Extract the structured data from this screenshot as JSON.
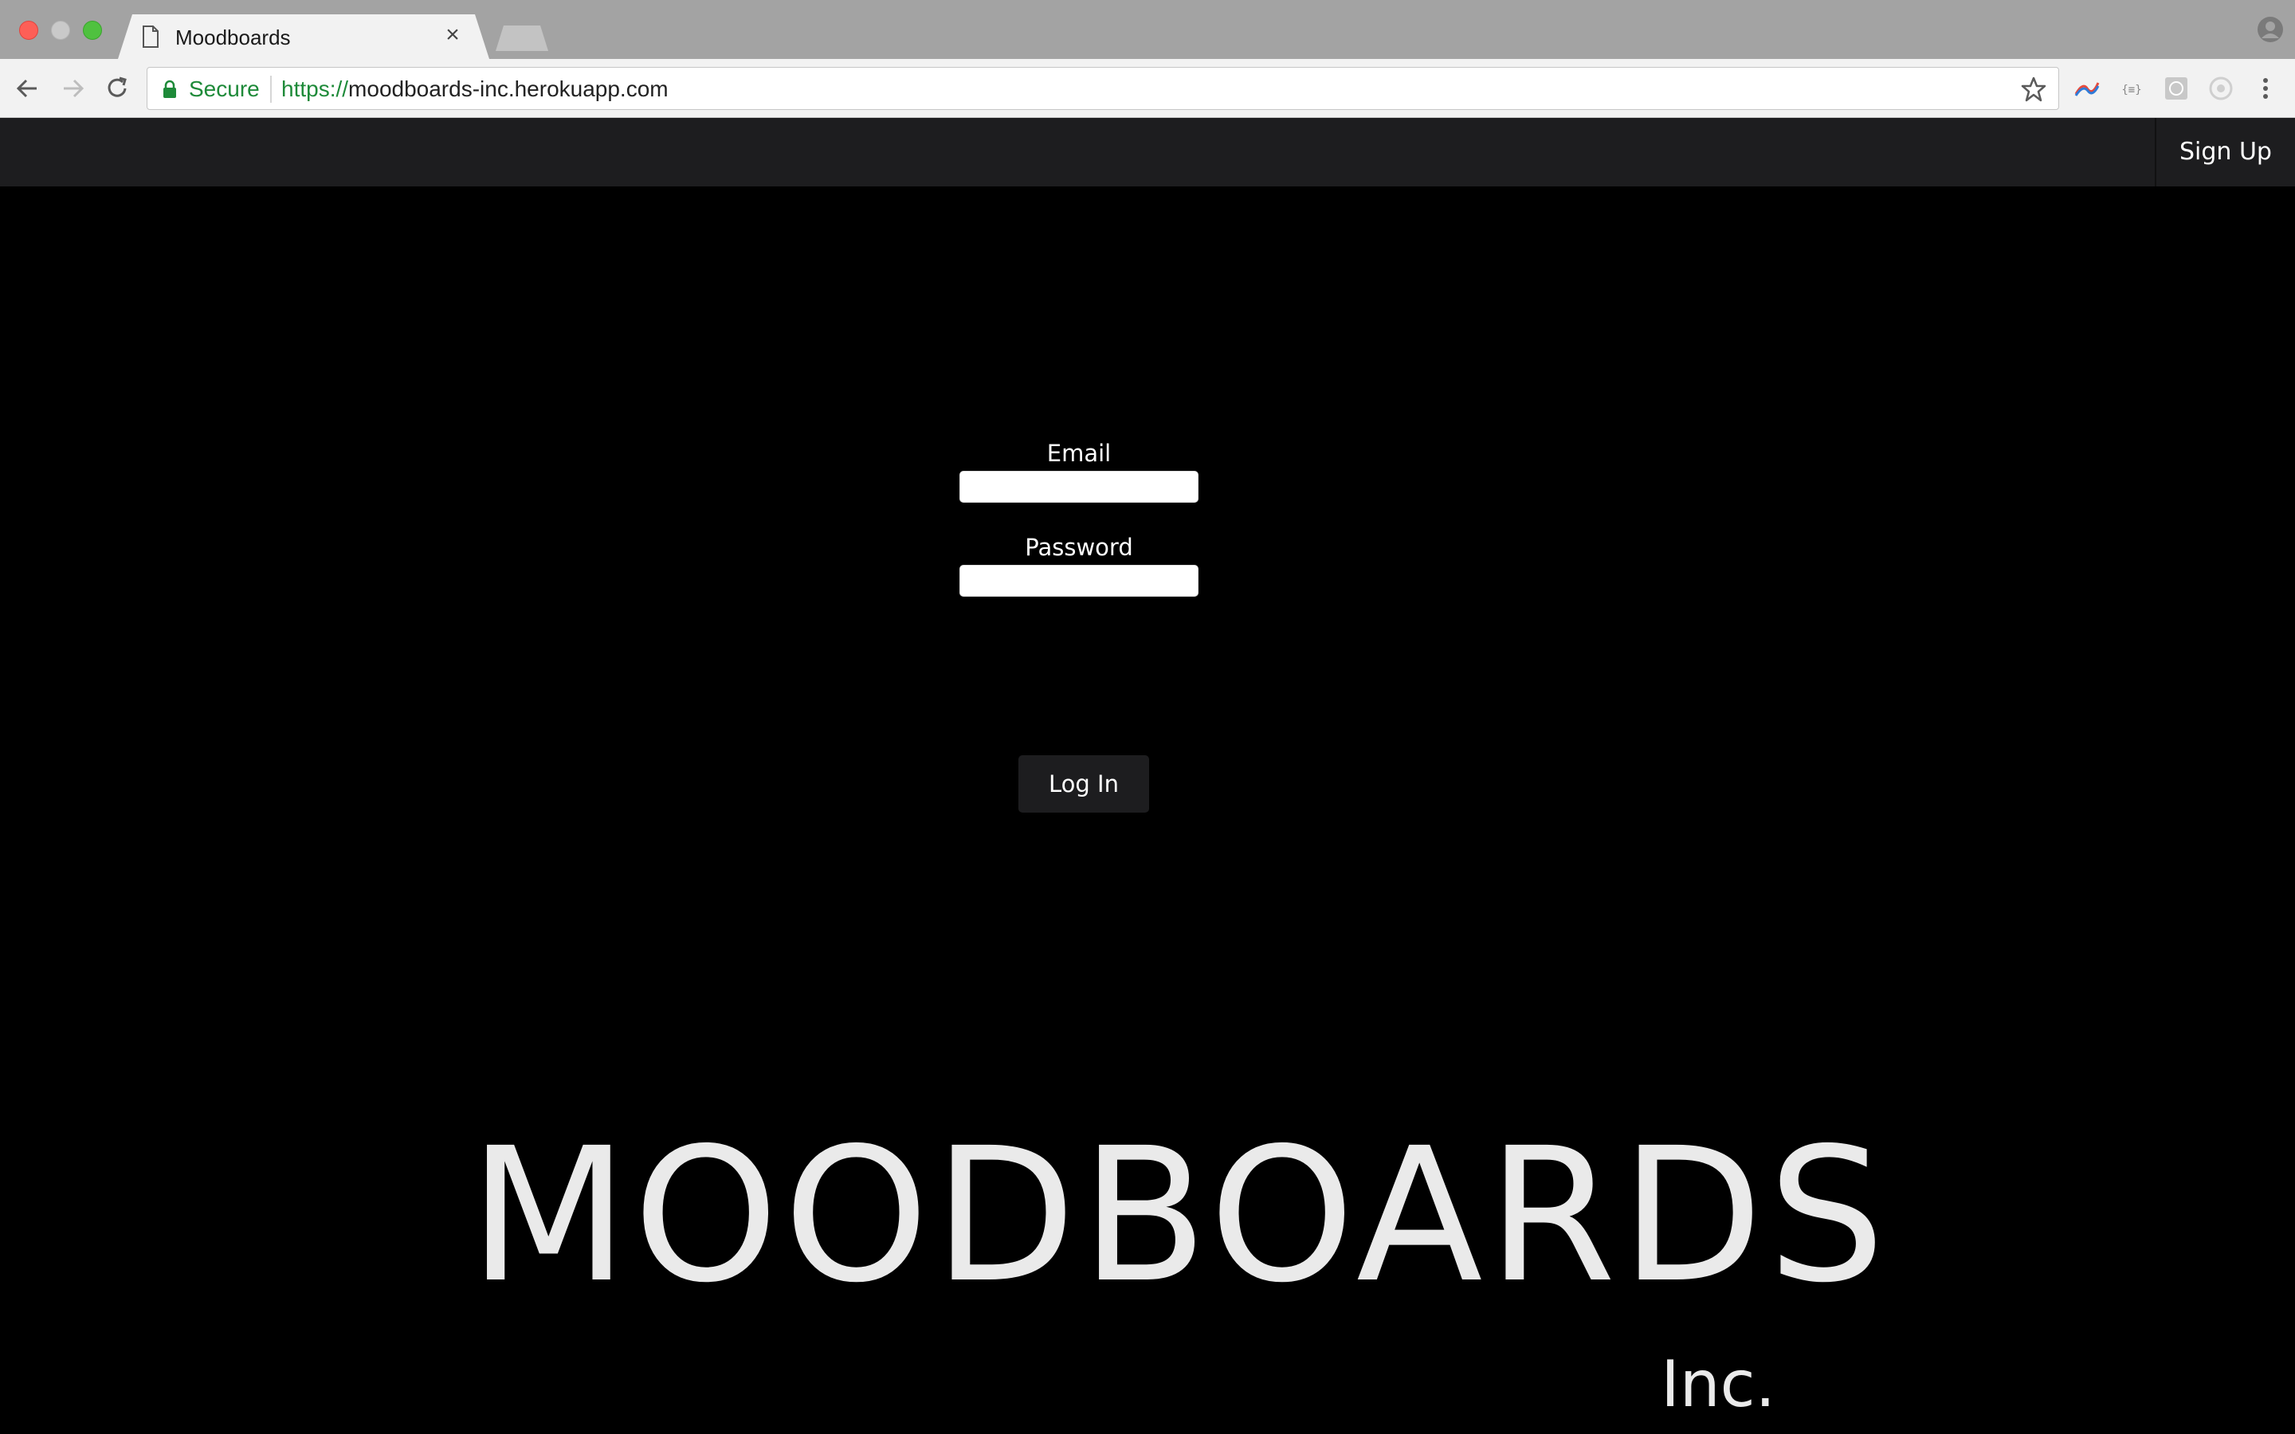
{
  "browser": {
    "tab": {
      "title": "Moodboards",
      "close_glyph": "×"
    },
    "omnibox": {
      "secure_label": "Secure",
      "url_scheme": "https://",
      "url_host": "moodboards-inc.herokuapp.com"
    },
    "icons": [
      "page-icon",
      "close-icon",
      "back-icon",
      "forward-icon",
      "reload-icon",
      "lock-icon",
      "star-icon",
      "extension-icon",
      "menu-icon",
      "profile-icon"
    ]
  },
  "navbar": {
    "signup_label": "Sign Up"
  },
  "login_form": {
    "email_label": "Email",
    "email_value": "",
    "password_label": "Password",
    "password_value": "",
    "submit_label": "Log In"
  },
  "brand": {
    "title": "MOODBOARDS",
    "subtitle": "Inc."
  },
  "colors": {
    "page_background": "#000000",
    "navbar_background": "#1d1d1f",
    "text": "#ffffff",
    "secure_green": "#1e8a39"
  }
}
